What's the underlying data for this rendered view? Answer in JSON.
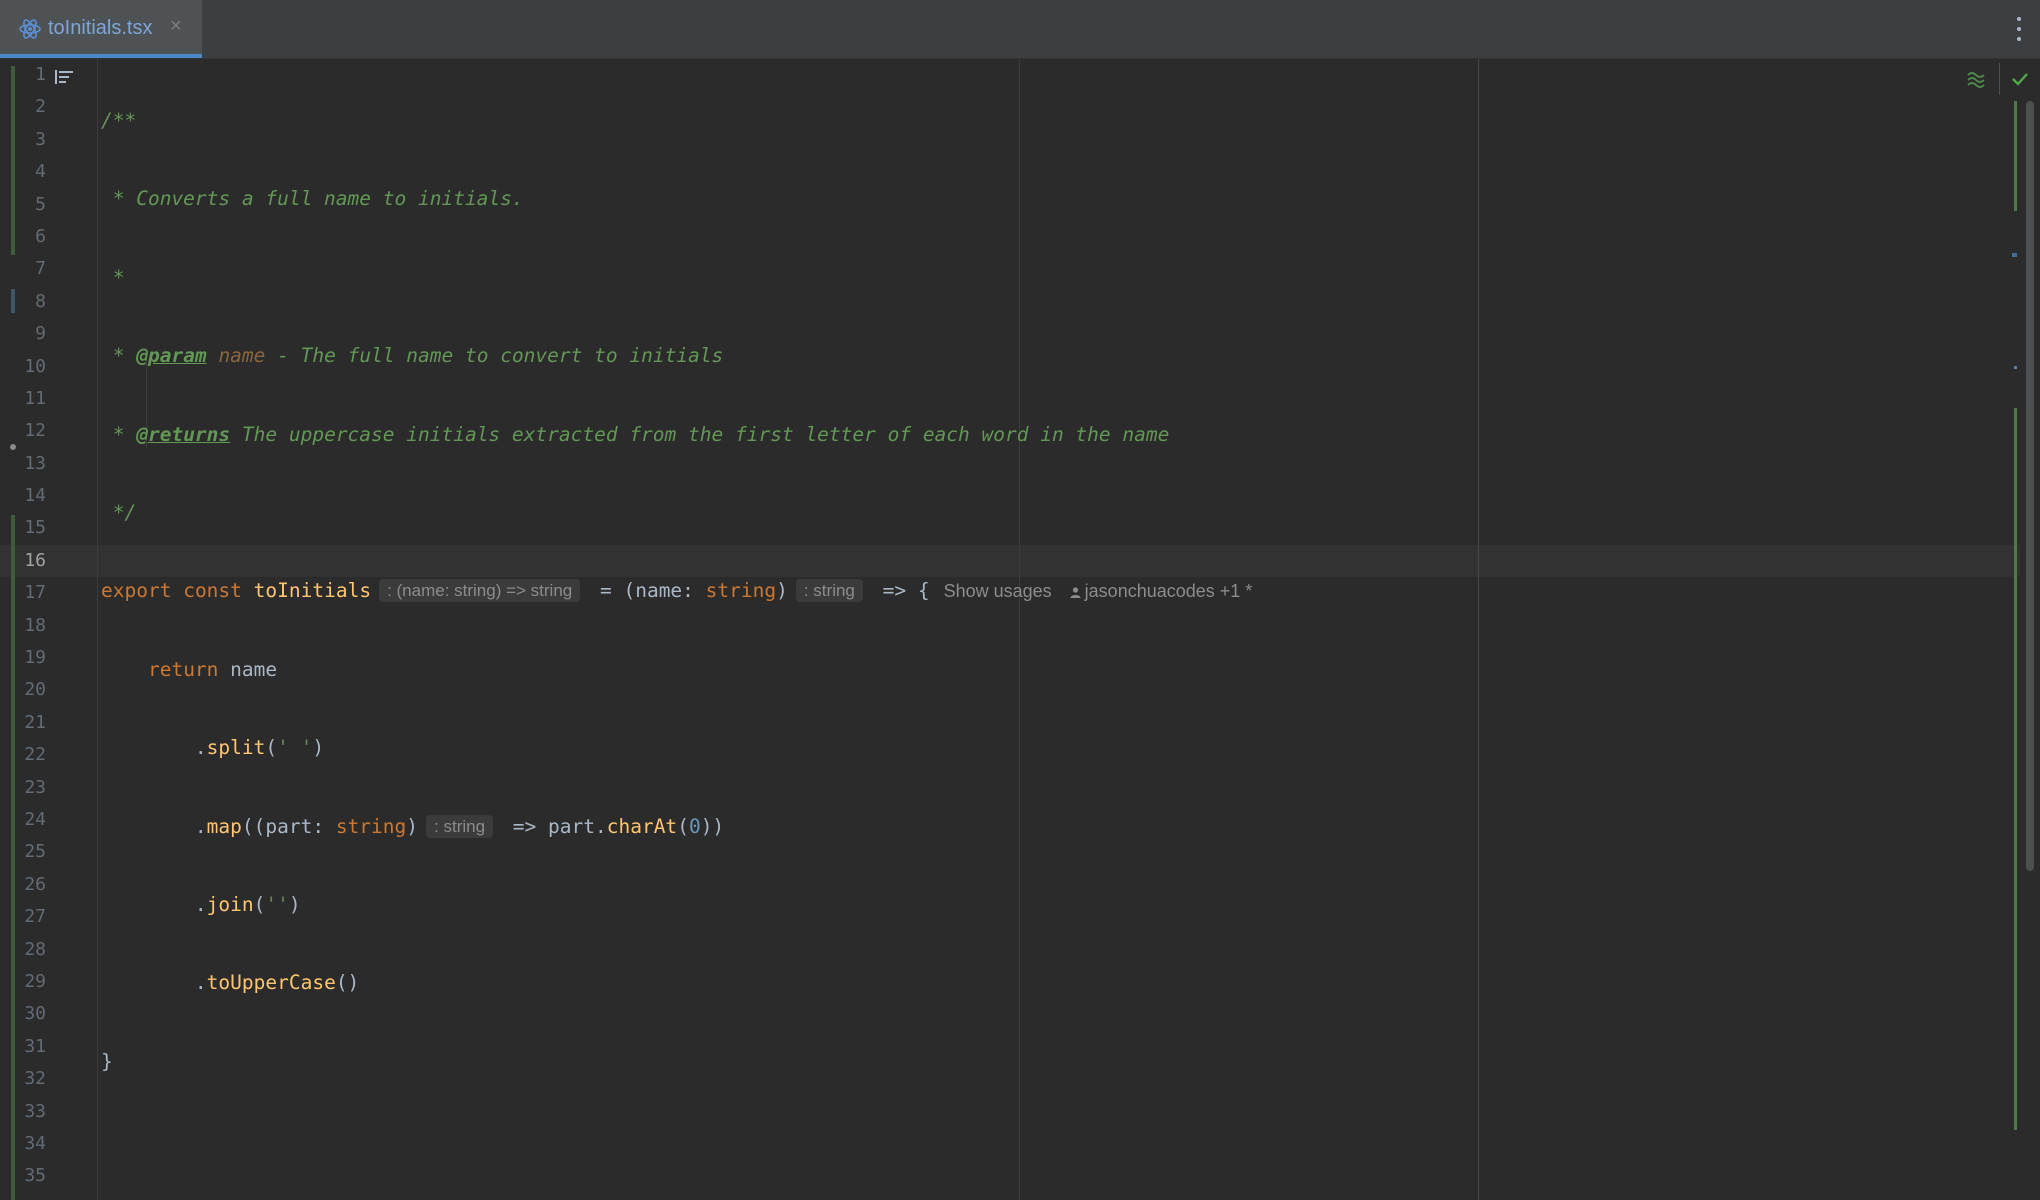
{
  "tab": {
    "filename": "toInitials.tsx",
    "close_glyph": "×",
    "icon": "react-file-icon",
    "accent": "#4a88c7"
  },
  "editor": {
    "current_line": 16,
    "line_numbers": [
      "1",
      "2",
      "3",
      "4",
      "5",
      "6",
      "7",
      "8",
      "9",
      "10",
      "11",
      "12",
      "13",
      "14",
      "15",
      "16",
      "17",
      "18",
      "19",
      "20",
      "21",
      "22",
      "23",
      "24",
      "25",
      "26",
      "27",
      "28",
      "29",
      "30",
      "31",
      "32",
      "33",
      "34",
      "35"
    ],
    "code": {
      "l1": "/**",
      "l2": " * Converts a full name to initials.",
      "l3": " *",
      "l4_star": " * ",
      "l4_tag": "@param",
      "l4_name": "name",
      "l4_rest": " - The full name to convert to initials",
      "l5_star": " * ",
      "l5_tag": "@returns",
      "l5_rest": " The uppercase initials extracted from the first letter of each word in the name",
      "l6": " */",
      "l7_export": "export",
      "l7_const": "const",
      "l7_fn": "toInitials",
      "l7_hint_type": ": (name: string) => string",
      "l7_eq": " = (name: ",
      "l7_string": "string",
      "l7_close": ")",
      "l7_hint_ret": ": string",
      "l7_arrow": " => {",
      "l7_usages": "Show usages",
      "l7_author": "jasonchuacodes +1 *",
      "l8_return": "return",
      "l8_rest": " name",
      "l9_dot": ".",
      "l9_fn": "split",
      "l9_open": "(",
      "l9_str": "' '",
      "l9_close": ")",
      "l10_dot": ".",
      "l10_fn": "map",
      "l10_a": "((part: ",
      "l10_string": "string",
      "l10_b": ")",
      "l10_hint": ": string",
      "l10_c": " => part.",
      "l10_fn2": "charAt",
      "l10_d": "(",
      "l10_num": "0",
      "l10_e": "))",
      "l11_dot": ".",
      "l11_fn": "join",
      "l11_open": "(",
      "l11_str": "''",
      "l11_close": ")",
      "l12_dot": ".",
      "l12_fn": "toUpperCase",
      "l12_parens": "()",
      "l13": "}"
    },
    "icons": {
      "gutter": "reader-mode-icon",
      "inspection": "inspection-widget-icon",
      "status": "check-icon",
      "menu": "more-vertical-icon",
      "author": "person-icon"
    },
    "colors": {
      "background": "#2b2b2b",
      "keyword": "#cc7832",
      "function": "#ffc66d",
      "comment": "#629755",
      "number": "#6897bb",
      "text": "#a9b7c6"
    }
  }
}
